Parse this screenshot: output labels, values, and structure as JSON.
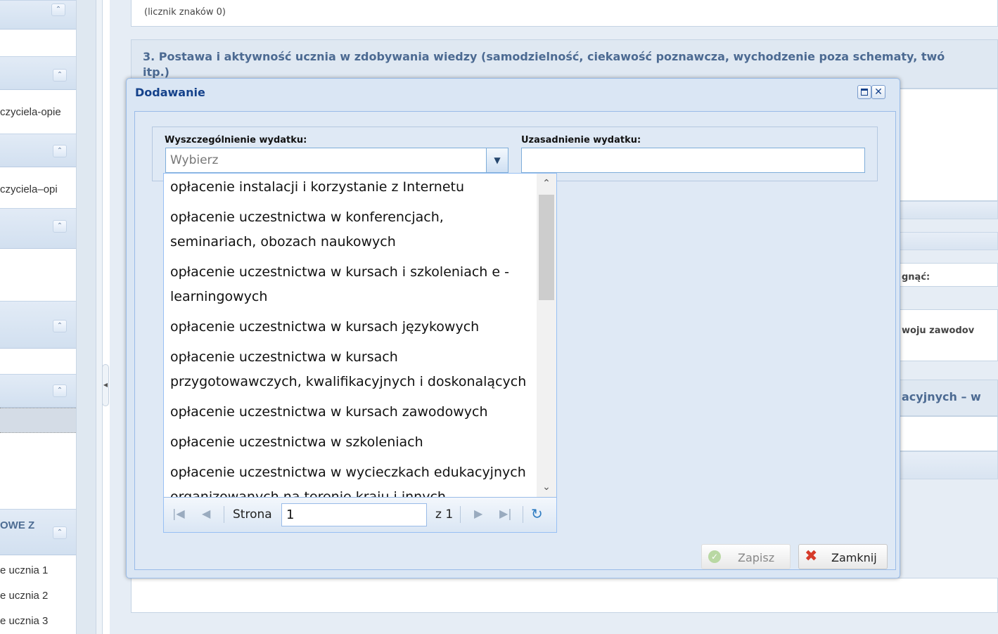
{
  "sidebar": {
    "items": [
      {
        "label": "czyciela-opie"
      },
      {
        "label": "czyciela–opi"
      }
    ],
    "section_header": "OWE Z",
    "student_items": [
      {
        "label": "e ucznia 1"
      },
      {
        "label": "e ucznia 2"
      },
      {
        "label": "e ucznia 3"
      }
    ]
  },
  "background": {
    "char_counter": "(licznik znaków 0)",
    "section3_title_line1": "3. Postawa i aktywność ucznia w zdobywania wiedzy (samodzielność, ciekawość poznawcza, wychodzenie poza schematy, twó",
    "section3_title_line2": "itp.)",
    "partial_label_1": "gnąć:",
    "partial_label_2": "woju zawodov",
    "partial_label_3": "acyjnych – w"
  },
  "dialog": {
    "title": "Dodawanie",
    "field_specification_label": "Wyszczególnienie wydatku:",
    "field_specification_placeholder": "Wybierz",
    "field_justification_label": "Uzasadnienie wydatku:",
    "field_justification_value": "",
    "dropdown_options": [
      "opłacenie instalacji i korzystanie z Internetu",
      "opłacenie uczestnictwa w konferencjach, seminariach, obozach naukowych",
      "opłacenie uczestnictwa w kursach i szkoleniach e - learningowych",
      "opłacenie uczestnictwa w kursach językowych",
      "opłacenie uczestnictwa w kursach przygotowawczych, kwalifikacyjnych i doskonalących",
      "opłacenie uczestnictwa w kursach zawodowych",
      "opłacenie uczestnictwa w szkoleniach",
      "opłacenie uczestnictwa w wycieczkach edukacyjnych organizowanych na terenie kraju i innych wydarzeniach poszerzających wiedzę, rozwijających zdolności i"
    ],
    "pager": {
      "page_label": "Strona",
      "page_value": "1",
      "of_label": "z 1"
    },
    "buttons": {
      "save": "Zapisz",
      "close": "Zamknij"
    }
  },
  "colors": {
    "title_blue": "#15428b",
    "section_blue": "#4c6a92",
    "dialog_bg": "#dfe9f5",
    "border_blue": "#99bbe8"
  },
  "icons": [
    "collapse-up-icon",
    "maximize-icon",
    "close-icon",
    "dropdown-arrow-icon",
    "scroll-up-icon",
    "scroll-down-icon",
    "first-page-icon",
    "prev-page-icon",
    "next-page-icon",
    "last-page-icon",
    "refresh-icon",
    "check-icon",
    "x-icon"
  ]
}
